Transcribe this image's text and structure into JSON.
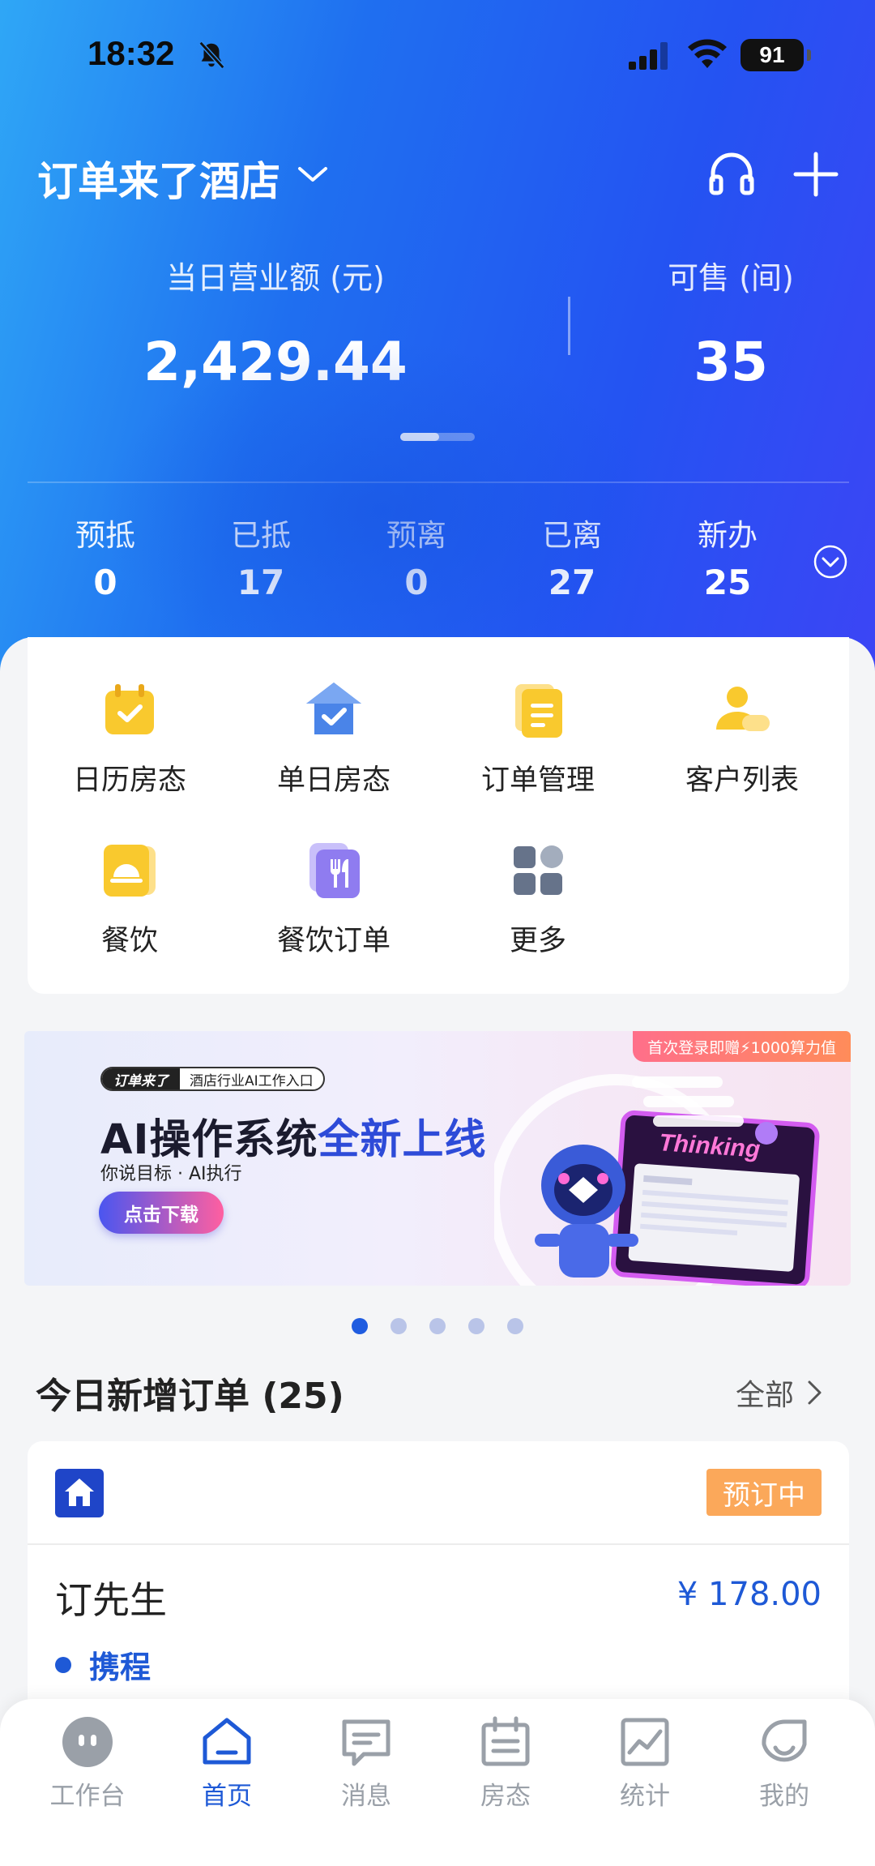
{
  "status_bar": {
    "time": "18:32",
    "battery": "91"
  },
  "header": {
    "hotel_name": "订单来了酒店"
  },
  "stats": {
    "revenue_label": "当日营业额 (元)",
    "revenue_value": "2,429.44",
    "available_label": "可售 (间)",
    "available_value": "35"
  },
  "counts": [
    {
      "label": "预抵",
      "value": "0"
    },
    {
      "label": "已抵",
      "value": "17"
    },
    {
      "label": "预离",
      "value": "0"
    },
    {
      "label": "已离",
      "value": "27"
    },
    {
      "label": "新办",
      "value": "25"
    }
  ],
  "menu": [
    {
      "label": "日历房态",
      "icon": "calendar-check-icon",
      "color": "#f9c92e"
    },
    {
      "label": "单日房态",
      "icon": "house-check-icon",
      "color": "#4a84e8"
    },
    {
      "label": "订单管理",
      "icon": "clipboard-icon",
      "color": "#f9c92e"
    },
    {
      "label": "客户列表",
      "icon": "users-icon",
      "color": "#f9c92e"
    },
    {
      "label": "餐饮",
      "icon": "dining-cloche-icon",
      "color": "#f9c92e"
    },
    {
      "label": "餐饮订单",
      "icon": "utensils-icon",
      "color": "#8f7cf0"
    },
    {
      "label": "更多",
      "icon": "grid-icon",
      "color": "#66738a"
    }
  ],
  "banner": {
    "promo": "首次登录即赠⚡1000算力值",
    "brand": "订单来了",
    "tag": "酒店行业AI工作入口",
    "title_part1": "AI操作系统",
    "title_part2": "全新上线",
    "subtitle": "你说目标 · AI执行",
    "button": "点击下载",
    "screen_text": "Thinking"
  },
  "carousel": {
    "count": 5,
    "active": 0
  },
  "orders_section": {
    "title": "今日新增订单 (25)",
    "more": "全部"
  },
  "order": {
    "status": "预订中",
    "guest": "订先生",
    "price": "¥ 178.00",
    "channel": "携程"
  },
  "tabs": [
    {
      "label": "工作台",
      "icon": "robot-face-icon"
    },
    {
      "label": "首页",
      "icon": "home-icon",
      "active": true
    },
    {
      "label": "消息",
      "icon": "message-icon"
    },
    {
      "label": "房态",
      "icon": "calendar-icon"
    },
    {
      "label": "统计",
      "icon": "chart-icon"
    },
    {
      "label": "我的",
      "icon": "profile-icon"
    }
  ],
  "colors": {
    "accent": "#1e59d6",
    "status_badge": "#fba85a",
    "hero_start": "#2fa7f6",
    "hero_end": "#3c45f5"
  }
}
